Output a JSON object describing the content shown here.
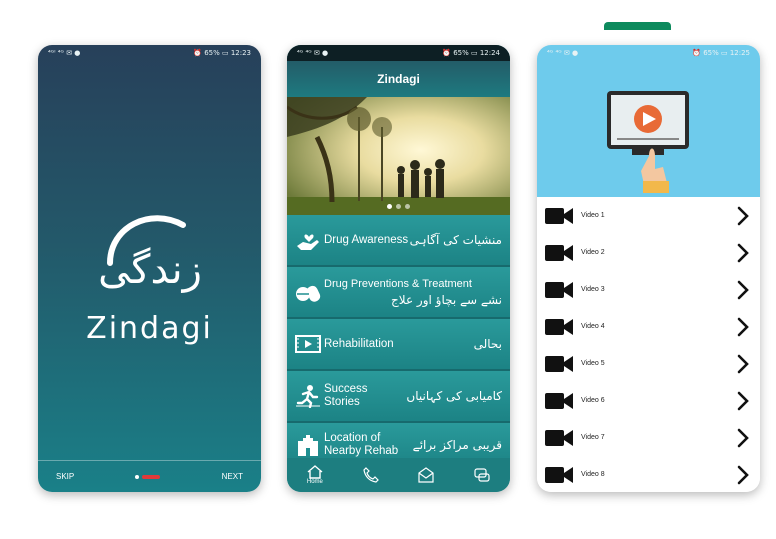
{
  "phone1": {
    "status_left": "⁴ᴳᴵ ⁴ᴳ ✉ ●",
    "status_right": "⏰ 65% ▭ 12:23",
    "logo_urdu": "زندگی",
    "title": "Zindagi",
    "skip_label": "SKIP",
    "next_label": "NEXT"
  },
  "phone2": {
    "status_left": "⁴ᴳ ⁴ᴳ ✉ ●",
    "status_right": "⏰ 65% ▭ 12:24",
    "app_title": "Zindagi",
    "menu": [
      {
        "label": "Drug Awareness",
        "urdu": "منشیات کی آگاہی",
        "icon": "hand-heart-icon"
      },
      {
        "label": "Drug Preventions & Treatment",
        "urdu": "نشے سے بچاؤ اور علاج",
        "icon": "pills-icon"
      },
      {
        "label": "Rehabilitation",
        "urdu": "بحالی",
        "icon": "video-player-icon"
      },
      {
        "label": "Success Stories",
        "urdu": "کامیابی کی کہانیاں",
        "icon": "runner-icon"
      },
      {
        "label": "Location of Nearby Rehab",
        "urdu": "قریبی مراکز برائے",
        "icon": "hospital-icon"
      }
    ],
    "nav": [
      {
        "label": "Home",
        "icon": "home-icon"
      },
      {
        "label": "",
        "icon": "phone-icon"
      },
      {
        "label": "",
        "icon": "mail-icon"
      },
      {
        "label": "",
        "icon": "chat-icon"
      }
    ]
  },
  "phone3": {
    "status_left": "⁴ᴳ ⁴ᴳ ✉ ●",
    "status_right": "⏰ 65% ▭ 12:25",
    "videos": [
      "Video 1",
      "Video 2",
      "Video 3",
      "Video 4",
      "Video 5",
      "Video 6",
      "Video 7",
      "Video 8"
    ]
  },
  "colors": {
    "teal": "#1f8f91",
    "splash_top": "#27405a",
    "hero_blue": "#6ecbec",
    "pager_active": "#e03a3a"
  }
}
